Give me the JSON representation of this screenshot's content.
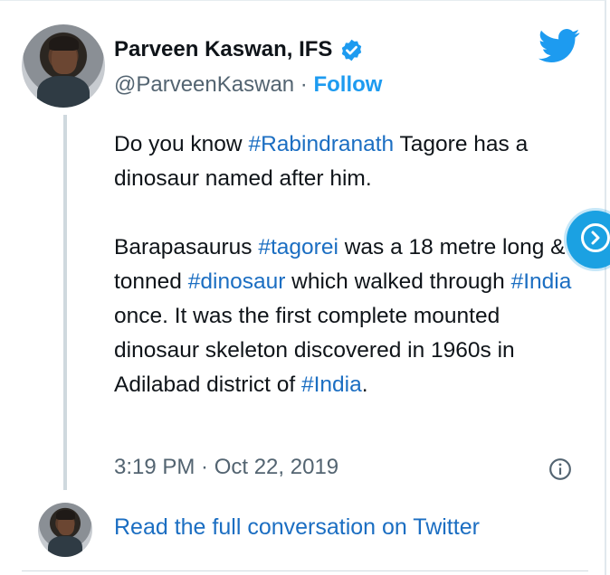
{
  "author": {
    "name": "Parveen Kaswan, IFS",
    "handle": "@ParveenKaswan",
    "separator": " · ",
    "follow_label": "Follow"
  },
  "tweet": {
    "paragraph1": {
      "t1": "Do you know ",
      "h1": "#Rabindranath",
      "t2": " Tagore has a dinosaur named after him."
    },
    "paragraph2": {
      "t1": "Barapasaurus ",
      "h1": "#tagorei",
      "t2": " was a 18 metre long & 7 tonned ",
      "h2": "#dinosaur",
      "t3": " which walked through ",
      "h3": "#India",
      "t4": " once. It was the first complete mounted dinosaur skeleton discovered in 1960s in Adilabad district of ",
      "h4": "#India",
      "t5": "."
    },
    "timestamp": "3:19 PM · Oct 22, 2019"
  },
  "footer": {
    "read_full_label": "Read the full conversation on Twitter"
  },
  "icons": {
    "verified": "verified-badge-icon",
    "twitter": "twitter-bird-icon",
    "info": "info-icon",
    "next": "chevron-right-circle-icon"
  },
  "colors": {
    "link": "#1b6ec2",
    "twitter_blue": "#1d9bf0",
    "text": "#0f1419",
    "muted": "#536471"
  }
}
